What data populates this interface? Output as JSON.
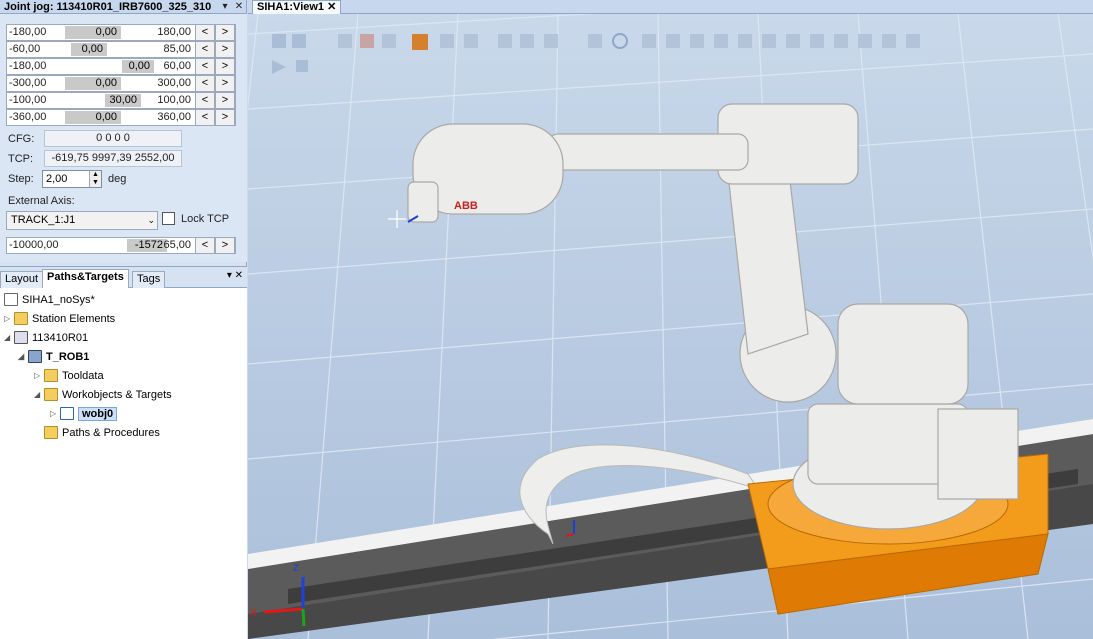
{
  "joint_jog": {
    "title": "Joint jog: 113410R01_IRB7600_325_310",
    "joints": [
      {
        "min": "-180,00",
        "value": "0,00",
        "max": "180,00"
      },
      {
        "min": "-60,00",
        "value": "0,00",
        "max": "85,00"
      },
      {
        "min": "-180,00",
        "value": "0,00",
        "max": "60,00"
      },
      {
        "min": "-300,00",
        "value": "0,00",
        "max": "300,00"
      },
      {
        "min": "-100,00",
        "value": "30,00",
        "max": "100,00"
      },
      {
        "min": "-360,00",
        "value": "0,00",
        "max": "360,00"
      }
    ],
    "dec_label": "<",
    "inc_label": ">",
    "cfg_label": "CFG:",
    "cfg_value": "0 0 0 0",
    "tcp_label": "TCP:",
    "tcp_value": "-619,75 9997,39 2552,00",
    "step_label": "Step:",
    "step_value": "2,00",
    "step_unit": "deg",
    "external_axis_label": "External Axis:",
    "external_axis_value": "TRACK_1:J1",
    "lock_tcp_label": "Lock TCP",
    "lock_tcp_checked": false,
    "track": {
      "min": "-10000,00",
      "value": "-1572",
      "max": "65,00"
    }
  },
  "browser": {
    "tabs": [
      "Layout",
      "Paths&Targets",
      "Tags"
    ],
    "active_tab": "Paths&Targets",
    "tree": [
      {
        "label": "SIHA1_noSys*",
        "icon": "station-icon"
      },
      {
        "label": "Station Elements",
        "icon": "folder-icon"
      },
      {
        "label": "113410R01",
        "icon": "controller-icon"
      },
      {
        "label": "T_ROB1",
        "icon": "task-icon"
      },
      {
        "label": "Tooldata",
        "icon": "folder-icon"
      },
      {
        "label": "Workobjects & Targets",
        "icon": "folder-icon"
      },
      {
        "label": "wobj0",
        "icon": "workobject-icon"
      },
      {
        "label": "Paths & Procedures",
        "icon": "folder-icon"
      }
    ]
  },
  "viewport": {
    "tab_title": "SIHA1:View1",
    "brand_text": "ABB",
    "axis_labels": {
      "x": "X",
      "y": "Y",
      "z": "Z"
    },
    "colors": {
      "robot": "#e9e9e7",
      "track_base": "#f28a12",
      "rail": "#595959",
      "floor": "#b9cbe2",
      "grid": "#dbe6f3"
    }
  }
}
